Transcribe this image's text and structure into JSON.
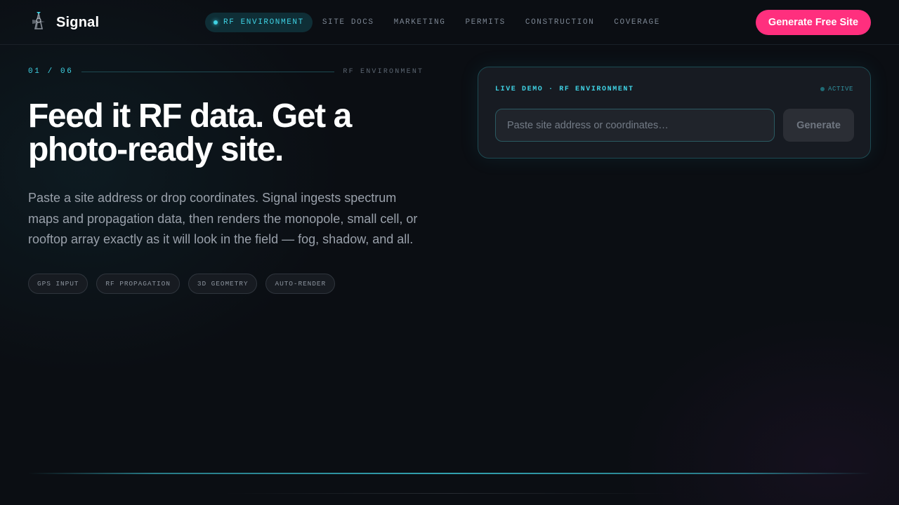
{
  "brand": {
    "name": "Signal",
    "logo_icon": "tower-logo-icon"
  },
  "nav": {
    "tabs": [
      {
        "label": "RF ENVIRONMENT",
        "active": true
      },
      {
        "label": "SITE DOCS",
        "active": false
      },
      {
        "label": "MARKETING",
        "active": false
      },
      {
        "label": "PERMITS",
        "active": false
      },
      {
        "label": "CONSTRUCTION",
        "active": false
      },
      {
        "label": "COVERAGE",
        "active": false
      }
    ],
    "cta_label": "Generate Free Site"
  },
  "hero": {
    "step_counter": "01 / 06",
    "step_label": "RF ENVIRONMENT",
    "headline": "Feed it RF data. Get a photo-ready site.",
    "subcopy": "Paste a site address or drop coordinates. Signal ingests spectrum maps and propagation data, then renders the monopole, small cell, or rooftop array exactly as it will look in the field — fog, shadow, and all.",
    "chips": [
      "GPS INPUT",
      "RF PROPAGATION",
      "3D GEOMETRY",
      "AUTO-RENDER"
    ]
  },
  "demo": {
    "title": "LIVE DEMO · RF ENVIRONMENT",
    "status": "ACTIVE",
    "input_value": "",
    "input_placeholder": "Paste site address or coordinates…",
    "button_label": "Generate"
  },
  "colors": {
    "accent": "#3fd2e4",
    "cta": "#ff2f7e",
    "background": "#0b0e13"
  }
}
